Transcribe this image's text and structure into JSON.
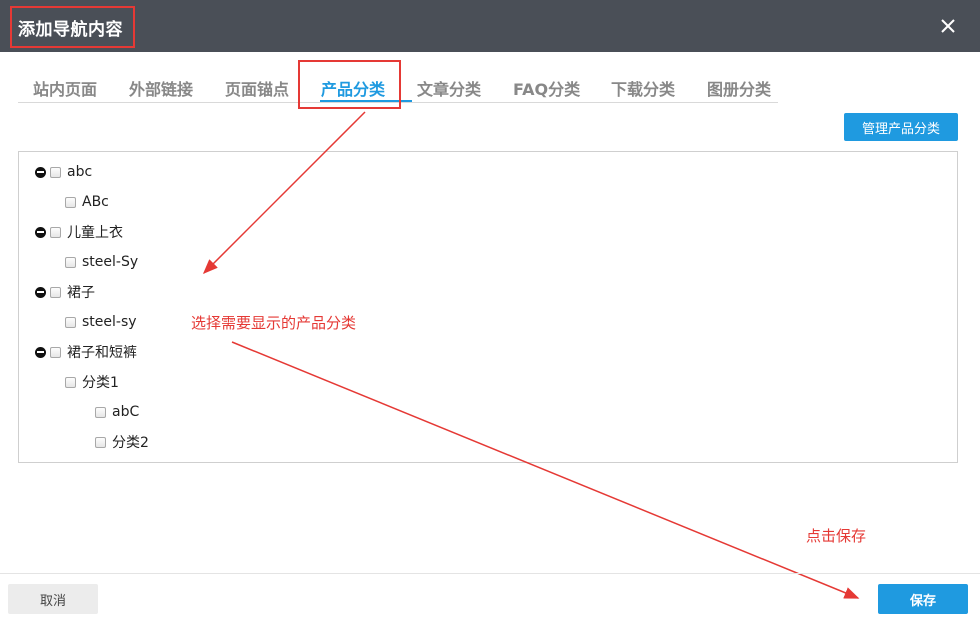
{
  "dialog": {
    "title": "添加导航内容",
    "close_icon": "close-icon"
  },
  "tabs": [
    {
      "label": "站内页面",
      "active": false
    },
    {
      "label": "外部链接",
      "active": false
    },
    {
      "label": "页面锚点",
      "active": false
    },
    {
      "label": "产品分类",
      "active": true
    },
    {
      "label": "文章分类",
      "active": false
    },
    {
      "label": "FAQ分类",
      "active": false
    },
    {
      "label": "下载分类",
      "active": false
    },
    {
      "label": "图册分类",
      "active": false
    }
  ],
  "toolbar": {
    "manage_label": "管理产品分类"
  },
  "tree": [
    {
      "label": "abc",
      "level": 0,
      "collapsible": true
    },
    {
      "label": "ABc",
      "level": 1,
      "collapsible": false
    },
    {
      "label": "儿童上衣",
      "level": 0,
      "collapsible": true
    },
    {
      "label": "steel-Sy",
      "level": 1,
      "collapsible": false
    },
    {
      "label": "裙子",
      "level": 0,
      "collapsible": true
    },
    {
      "label": "steel-sy",
      "level": 1,
      "collapsible": false
    },
    {
      "label": "裙子和短裤",
      "level": 0,
      "collapsible": true
    },
    {
      "label": "分类1",
      "level": 1,
      "collapsible": false
    },
    {
      "label": "abC",
      "level": 2,
      "collapsible": false
    },
    {
      "label": "分类2",
      "level": 2,
      "collapsible": false
    }
  ],
  "annotations": {
    "select_hint": "选择需要显示的产品分类",
    "save_hint": "点击保存"
  },
  "footer": {
    "cancel_label": "取消",
    "save_label": "保存"
  },
  "colors": {
    "accent": "#1f9ae0",
    "annotation": "#e53935",
    "header": "#4a4f57"
  }
}
